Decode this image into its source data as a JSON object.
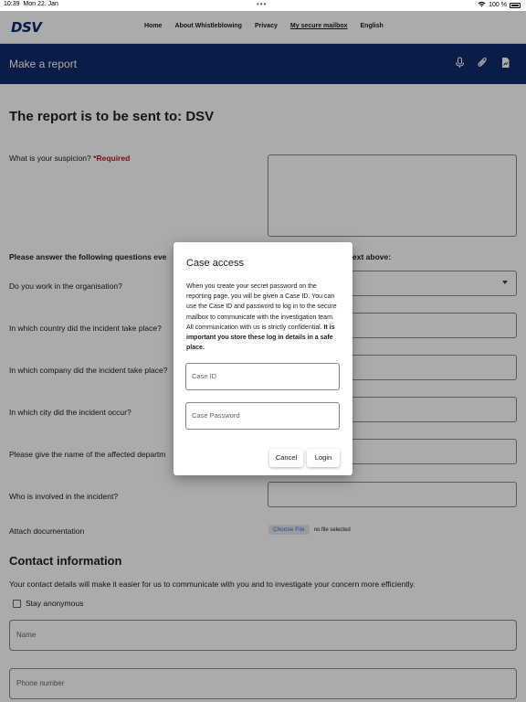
{
  "status_bar": {
    "time": "10:39",
    "date": "Mon 22. Jan",
    "battery": "100 %"
  },
  "nav": {
    "logo": "DSV",
    "links": [
      "Home",
      "About Whistleblowing",
      "Privacy",
      "My secure mailbox",
      "English"
    ]
  },
  "header": {
    "title": "Make a report",
    "icons": [
      "microphone-icon",
      "paperclip-icon",
      "document-icon"
    ],
    "color": "#102a6b"
  },
  "form": {
    "heading": "The report is to be sent to: DSV",
    "suspicion_label": "What is your suspicion?",
    "required": "*Required",
    "instructions_start": "Please answer the following questions eve",
    "instructions_end": "ext above:",
    "questions": [
      "Do you work in the organisation?",
      "In which country did the incident take place?",
      "In which company did the incident take place?",
      "In which city did the incident occur?",
      "Please give the name of the affected departm",
      "Who is involved in the incident?"
    ],
    "attach_label": "Attach documentation",
    "choose_file": "Choose File",
    "no_file": "no file selected"
  },
  "contact": {
    "heading": "Contact information",
    "text": "Your contact details will make it easier for us to communicate with you and to investigate your concern more efficiently.",
    "stay_anonymous": "Stay anonymous",
    "name_placeholder": "Name",
    "phone_placeholder": "Phone number"
  },
  "modal": {
    "title": "Case access",
    "body": "When you create your secret password on the reporting page,  you will be given a Case ID. You can use the Case ID and password to log in to the secure mailbox to communicate with the investigation team. All communication with us is strictly confidential.",
    "body_bold": "It is important you store these log in details in a safe place.",
    "case_id_placeholder": "Case ID",
    "case_password_placeholder": "Case Password",
    "cancel": "Cancel",
    "login": "Login"
  }
}
